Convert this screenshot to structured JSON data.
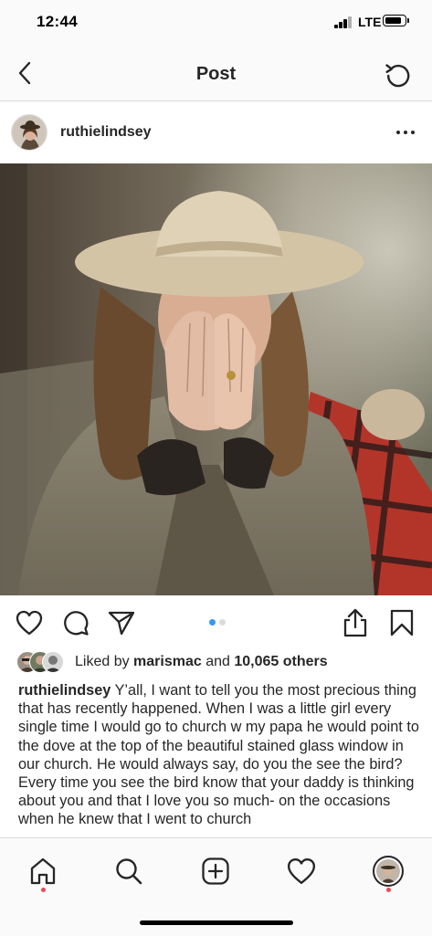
{
  "status_bar": {
    "time": "12:44",
    "network": "LTE",
    "battery_level": 0.85
  },
  "nav": {
    "title": "Post",
    "back_icon": "chevron-left-icon",
    "refresh_icon": "refresh-icon"
  },
  "post": {
    "username": "ruthielindsey",
    "more_icon": "more-horizontal-icon",
    "carousel": {
      "total": 2,
      "current": 1
    },
    "likes": {
      "prefix": "Liked by ",
      "user": "marismac",
      "middle": " and ",
      "others": "10,065 others"
    },
    "caption": {
      "username": "ruthielindsey",
      "text": " Y’all, I want to tell you the most precious thing that has recently happened. When I was a little girl every single time I would go to church w my papa he would point to the dove at the top of the beautiful stained glass window in our church. He would always say, do you the see the bird? Every time you see the bird know that your daddy is thinking about you and that I love you so much- on the occasions when he knew that I went to church"
    },
    "actions": [
      "heart-icon",
      "comment-icon",
      "share-send-icon",
      "upload-icon",
      "bookmark-icon"
    ]
  },
  "tab_bar": {
    "items": [
      "home-icon",
      "search-icon",
      "add-post-icon",
      "activity-heart-icon",
      "profile-avatar"
    ],
    "active": "home-icon"
  },
  "colors": {
    "accent_blue": "#3897f0",
    "notification_red": "#ed4956",
    "divider": "#dbdbdb"
  }
}
